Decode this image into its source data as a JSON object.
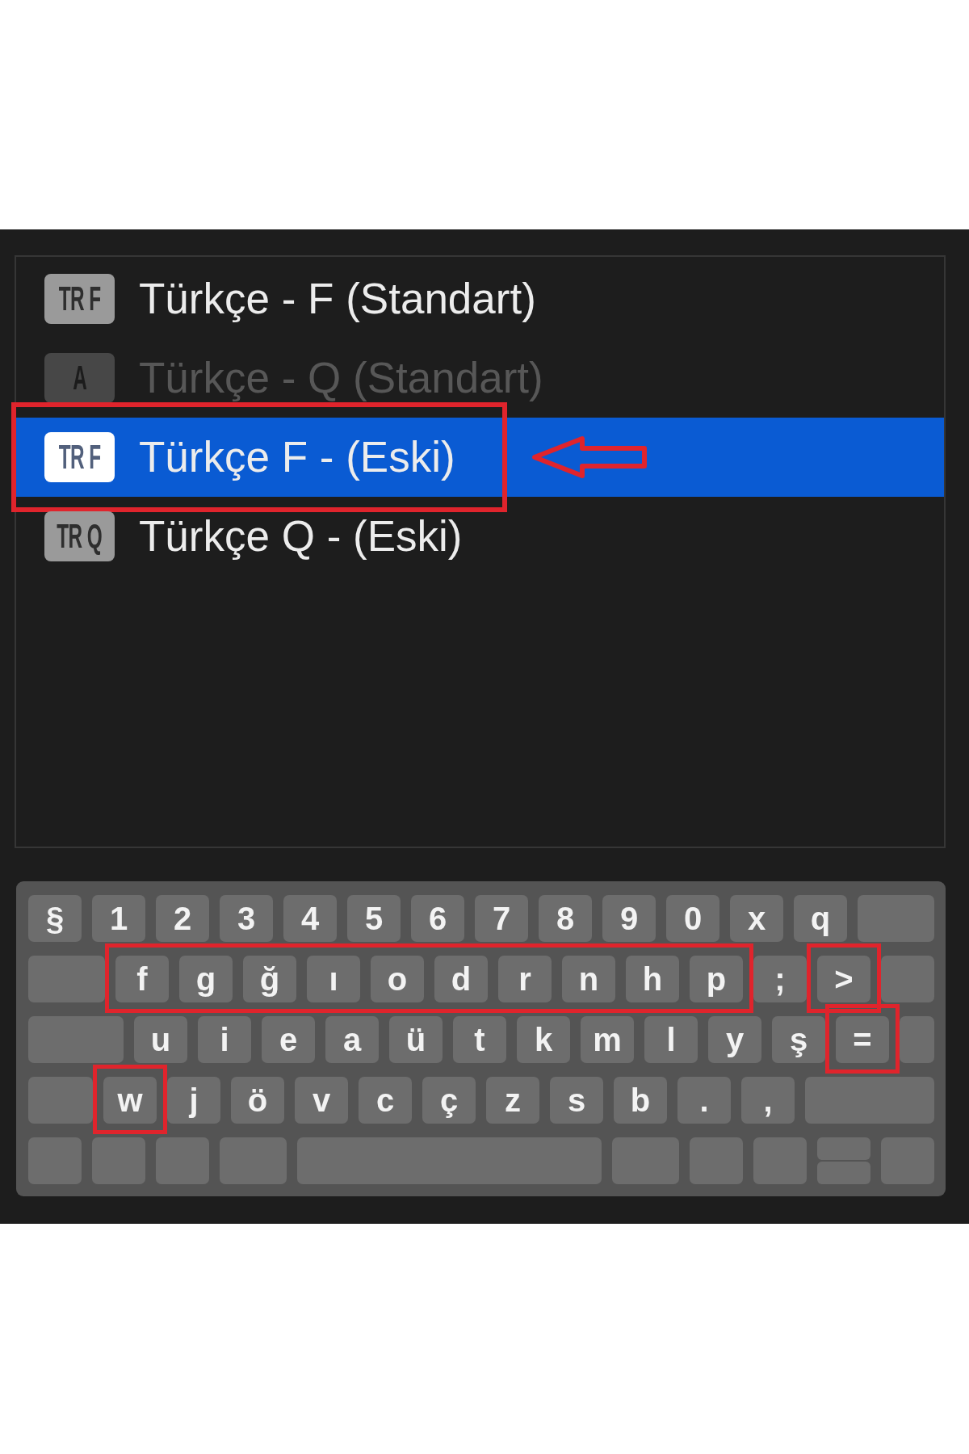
{
  "layouts": [
    {
      "badge": "TR F",
      "label": "Türkçe - F (Standart)",
      "selected": false,
      "disabled": false,
      "marked": false,
      "pointer": false
    },
    {
      "badge": "A",
      "label": "Türkçe - Q (Standart)",
      "selected": false,
      "disabled": true,
      "marked": false,
      "pointer": false
    },
    {
      "badge": "TR F",
      "label": "Türkçe F - (Eski)",
      "selected": true,
      "disabled": false,
      "marked": true,
      "pointer": true
    },
    {
      "badge": "TR Q",
      "label": "Türkçe Q - (Eski)",
      "selected": false,
      "disabled": false,
      "marked": false,
      "pointer": false
    }
  ],
  "keyboard": {
    "rows": [
      [
        {
          "kind": "char",
          "label": "§"
        },
        {
          "kind": "char",
          "label": "1"
        },
        {
          "kind": "char",
          "label": "2"
        },
        {
          "kind": "char",
          "label": "3"
        },
        {
          "kind": "char",
          "label": "4"
        },
        {
          "kind": "char",
          "label": "5"
        },
        {
          "kind": "char",
          "label": "6"
        },
        {
          "kind": "char",
          "label": "7"
        },
        {
          "kind": "char",
          "label": "8"
        },
        {
          "kind": "char",
          "label": "9"
        },
        {
          "kind": "char",
          "label": "0"
        },
        {
          "kind": "char",
          "label": "x"
        },
        {
          "kind": "char",
          "label": "q"
        },
        {
          "kind": "delete"
        }
      ],
      [
        {
          "kind": "tab"
        },
        {
          "kind": "group",
          "marked": true,
          "keys": [
            {
              "kind": "char",
              "label": "f"
            },
            {
              "kind": "char",
              "label": "g"
            },
            {
              "kind": "char",
              "label": "ğ"
            },
            {
              "kind": "char",
              "label": "ı"
            },
            {
              "kind": "char",
              "label": "o"
            },
            {
              "kind": "char",
              "label": "d"
            },
            {
              "kind": "char",
              "label": "r"
            },
            {
              "kind": "char",
              "label": "n"
            },
            {
              "kind": "char",
              "label": "h"
            },
            {
              "kind": "char",
              "label": "p"
            }
          ]
        },
        {
          "kind": "char",
          "label": ";"
        },
        {
          "kind": "group",
          "marked": true,
          "keys": [
            {
              "kind": "char",
              "label": ">"
            }
          ]
        },
        {
          "kind": "return"
        }
      ],
      [
        {
          "kind": "caps"
        },
        {
          "kind": "char",
          "label": "u"
        },
        {
          "kind": "char",
          "label": "i"
        },
        {
          "kind": "char",
          "label": "e"
        },
        {
          "kind": "char",
          "label": "a"
        },
        {
          "kind": "char",
          "label": "ü"
        },
        {
          "kind": "char",
          "label": "t"
        },
        {
          "kind": "char",
          "label": "k"
        },
        {
          "kind": "char",
          "label": "m"
        },
        {
          "kind": "char",
          "label": "l"
        },
        {
          "kind": "char",
          "label": "y"
        },
        {
          "kind": "char",
          "label": "ş"
        },
        {
          "kind": "group",
          "marked": true,
          "keys": [
            {
              "kind": "char",
              "label": "="
            }
          ]
        },
        {
          "kind": "return"
        }
      ],
      [
        {
          "kind": "left-shift"
        },
        {
          "kind": "group",
          "marked": true,
          "keys": [
            {
              "kind": "char",
              "label": "w"
            }
          ]
        },
        {
          "kind": "char",
          "label": "j"
        },
        {
          "kind": "char",
          "label": "ö"
        },
        {
          "kind": "char",
          "label": "v"
        },
        {
          "kind": "char",
          "label": "c"
        },
        {
          "kind": "char",
          "label": "ç"
        },
        {
          "kind": "char",
          "label": "z"
        },
        {
          "kind": "char",
          "label": "s"
        },
        {
          "kind": "char",
          "label": "b"
        },
        {
          "kind": "char",
          "label": "."
        },
        {
          "kind": "char",
          "label": ","
        },
        {
          "kind": "right-shift"
        }
      ],
      [
        {
          "kind": "fn"
        },
        {
          "kind": "control"
        },
        {
          "kind": "option"
        },
        {
          "kind": "command"
        },
        {
          "kind": "space"
        },
        {
          "kind": "command"
        },
        {
          "kind": "option"
        },
        {
          "kind": "arrow"
        },
        {
          "kind": "arrow-pair"
        },
        {
          "kind": "arrow"
        }
      ]
    ]
  }
}
